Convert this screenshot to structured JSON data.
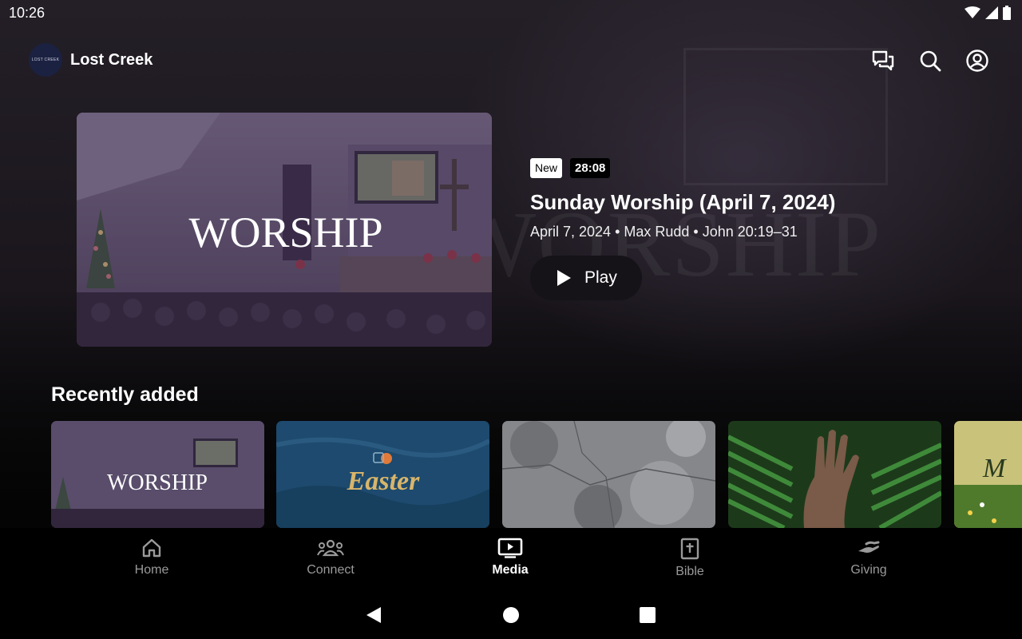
{
  "status": {
    "time": "10:26"
  },
  "header": {
    "app_name": "Lost Creek",
    "logo_text": "LOST CREEK"
  },
  "background": {
    "ghost_word": "WORSHIP"
  },
  "hero": {
    "thumb_title": "WORSHIP",
    "badge_new": "New",
    "duration": "28:08",
    "title": "Sunday Worship (April 7, 2024)",
    "subtitle": "April 7, 2024 • Max Rudd • John 20:19–31",
    "play_label": "Play"
  },
  "recently_added": {
    "title": "Recently added",
    "cards": [
      {
        "title": "WORSHIP",
        "icon": "worship-thumbnail"
      },
      {
        "title": "Easter",
        "icon": "easter-thumbnail"
      },
      {
        "title": "",
        "icon": "stone-texture-thumbnail"
      },
      {
        "title": "",
        "icon": "hand-palm-thumbnail"
      },
      {
        "title": "M",
        "icon": "meadow-thumbnail"
      }
    ]
  },
  "bottom_nav": {
    "items": [
      {
        "label": "Home",
        "icon": "home-icon"
      },
      {
        "label": "Connect",
        "icon": "people-icon"
      },
      {
        "label": "Media",
        "icon": "media-icon",
        "active": true
      },
      {
        "label": "Bible",
        "icon": "bible-icon"
      },
      {
        "label": "Giving",
        "icon": "giving-icon"
      }
    ]
  },
  "colors": {
    "background": "#000000",
    "accent": "#ffffff",
    "inactive": "#9a9a9a",
    "easter_text": "#d8b56a",
    "easter_bg": "#1d4a6e"
  }
}
